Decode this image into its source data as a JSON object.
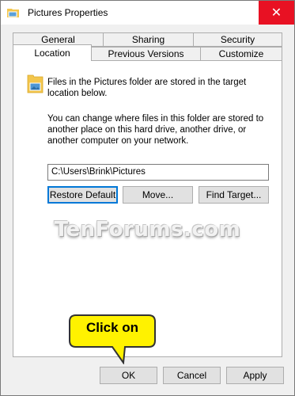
{
  "window": {
    "title": "Pictures Properties",
    "close_label": "✕"
  },
  "tabs": {
    "row1": [
      "General",
      "Sharing",
      "Security"
    ],
    "row2": [
      "Location",
      "Previous Versions",
      "Customize"
    ],
    "active": "Location"
  },
  "location": {
    "info_text": "Files in the Pictures folder are stored in the target location below.",
    "description": "You can change where files in this folder are stored to another place on this hard drive, another drive, or another computer on your network.",
    "path_value": "C:\\Users\\Brink\\Pictures",
    "restore_default_label": "Restore Default",
    "move_label": "Move...",
    "find_target_label": "Find Target..."
  },
  "watermark": "TenForums.com",
  "callout": {
    "text": "Click on",
    "color": "#fff200"
  },
  "footer": {
    "ok_label": "OK",
    "cancel_label": "Cancel",
    "apply_label": "Apply"
  },
  "colors": {
    "close_button": "#e81123",
    "focus_border": "#0078d7",
    "window_bg": "#f0f0f0"
  },
  "icons": {
    "title": "folder-pictures-icon",
    "info": "folder-pictures-icon",
    "close": "close-icon"
  }
}
